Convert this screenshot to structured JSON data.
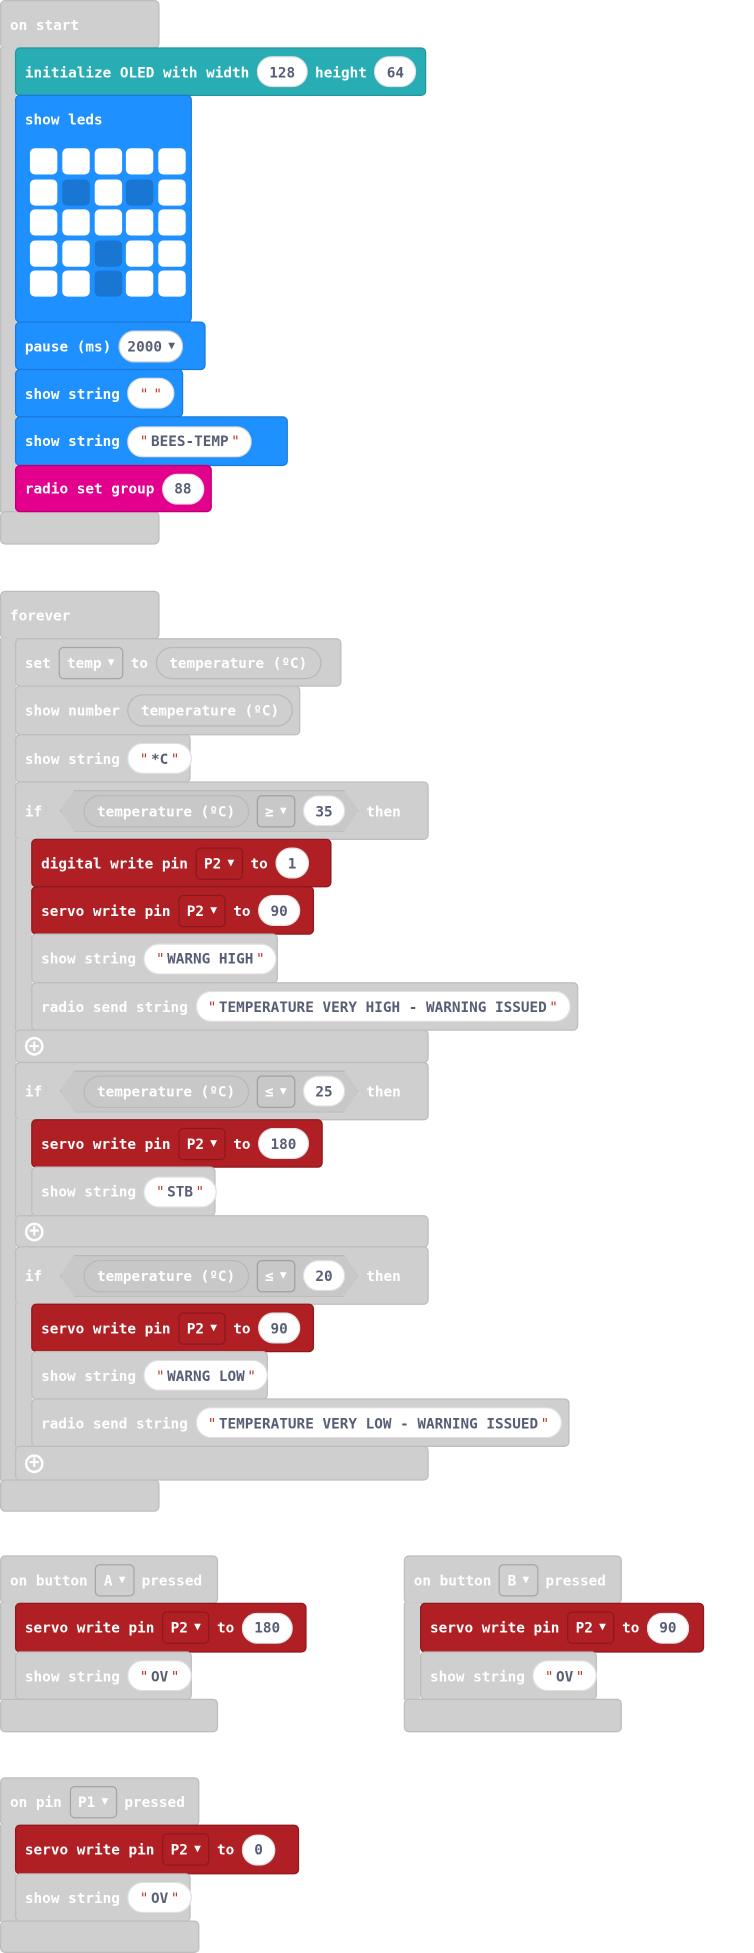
{
  "on_start": {
    "title": "on start",
    "init_oled": {
      "label": "initialize OLED with width",
      "width": "128",
      "height_label": "height",
      "height": "64"
    },
    "show_leds": {
      "label": "show leds",
      "grid": [
        [
          1,
          1,
          1,
          1,
          1
        ],
        [
          1,
          0,
          1,
          0,
          1
        ],
        [
          1,
          1,
          1,
          1,
          1
        ],
        [
          1,
          1,
          0,
          1,
          1
        ],
        [
          1,
          1,
          0,
          1,
          1
        ]
      ]
    },
    "pause": {
      "label": "pause (ms)",
      "value": "2000"
    },
    "show_string_1": {
      "label": "show string",
      "value": " "
    },
    "show_string_2": {
      "label": "show string",
      "value": "BEES-TEMP"
    },
    "radio_group": {
      "label": "radio set group",
      "value": "88"
    }
  },
  "forever": {
    "title": "forever",
    "set_var": {
      "label": "set",
      "variable": "temp",
      "to": "to",
      "value": "temperature (ºC)"
    },
    "show_number": {
      "label": "show number",
      "value": "temperature (ºC)"
    },
    "show_string": {
      "label": "show string",
      "value": "*C"
    },
    "if_1": {
      "if": "if",
      "then": "then",
      "sensor": "temperature (ºC)",
      "op": "≥",
      "threshold": "35",
      "digital_write": {
        "label": "digital write pin",
        "pin": "P2",
        "to": "to",
        "value": "1"
      },
      "servo": {
        "label": "servo write pin",
        "pin": "P2",
        "to": "to",
        "value": "90"
      },
      "show_string": {
        "label": "show string",
        "value": "WARNG HIGH"
      },
      "radio_send": {
        "label": "radio send string",
        "value": "TEMPERATURE VERY HIGH - WARNING ISSUED"
      }
    },
    "if_2": {
      "if": "if",
      "then": "then",
      "sensor": "temperature (ºC)",
      "op": "≤",
      "threshold": "25",
      "servo": {
        "label": "servo write pin",
        "pin": "P2",
        "to": "to",
        "value": "180"
      },
      "show_string": {
        "label": "show string",
        "value": "STB"
      }
    },
    "if_3": {
      "if": "if",
      "then": "then",
      "sensor": "temperature (ºC)",
      "op": "≤",
      "threshold": "20",
      "servo": {
        "label": "servo write pin",
        "pin": "P2",
        "to": "to",
        "value": "90"
      },
      "show_string": {
        "label": "show string",
        "value": "WARNG LOW"
      },
      "radio_send": {
        "label": "radio send string",
        "value": "TEMPERATURE VERY LOW - WARNING ISSUED"
      }
    }
  },
  "button_a": {
    "on": "on button",
    "button": "A",
    "pressed": "pressed",
    "servo": {
      "label": "servo write pin",
      "pin": "P2",
      "to": "to",
      "value": "180"
    },
    "show_string": {
      "label": "show string",
      "value": "OV"
    }
  },
  "button_b": {
    "on": "on button",
    "button": "B",
    "pressed": "pressed",
    "servo": {
      "label": "servo write pin",
      "pin": "P2",
      "to": "to",
      "value": "90"
    },
    "show_string": {
      "label": "show string",
      "value": "OV"
    }
  },
  "pin_p1": {
    "on": "on pin",
    "pin": "P1",
    "pressed": "pressed",
    "servo": {
      "label": "servo write pin",
      "pin": "P2",
      "to": "to",
      "value": "0"
    },
    "show_string": {
      "label": "show string",
      "value": "OV"
    }
  },
  "colors": {
    "basic": "#1E90FF",
    "oled": "#28ADB5",
    "radio": "#E3008C",
    "pins": "#B01F24",
    "disabled": "#CFCFCF",
    "led_off": "#1976D2"
  }
}
